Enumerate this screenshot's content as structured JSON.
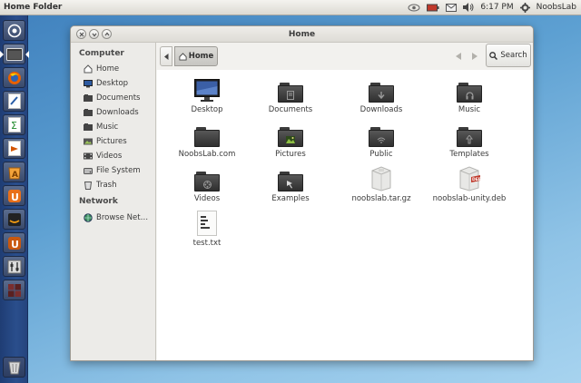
{
  "top_panel": {
    "title": "Home Folder",
    "clock": "6:17 PM",
    "user": "NoobsLab"
  },
  "launcher": {
    "items": [
      "dash-home",
      "file-manager",
      "firefox",
      "libreoffice-writer",
      "libreoffice-calc",
      "libreoffice-impress",
      "software-center",
      "ubuntu-one",
      "amazon",
      "ubuntu-one-music",
      "system-settings",
      "workspace-switcher",
      "trash"
    ]
  },
  "window": {
    "title": "Home"
  },
  "sidebar": {
    "sections": [
      {
        "heading": "Computer",
        "items": [
          {
            "label": "Home",
            "icon": "home-icon"
          },
          {
            "label": "Desktop",
            "icon": "desktop-icon"
          },
          {
            "label": "Documents",
            "icon": "folder-icon"
          },
          {
            "label": "Downloads",
            "icon": "folder-icon"
          },
          {
            "label": "Music",
            "icon": "folder-icon"
          },
          {
            "label": "Pictures",
            "icon": "pictures-icon"
          },
          {
            "label": "Videos",
            "icon": "videos-icon"
          },
          {
            "label": "File System",
            "icon": "drive-icon"
          },
          {
            "label": "Trash",
            "icon": "trash-icon"
          }
        ]
      },
      {
        "heading": "Network",
        "items": [
          {
            "label": "Browse Net…",
            "icon": "network-icon"
          }
        ]
      }
    ]
  },
  "toolbar": {
    "breadcrumb": "Home",
    "search_label": "Search"
  },
  "files": [
    {
      "name": "Desktop",
      "type": "desktop"
    },
    {
      "name": "Documents",
      "type": "folder-documents"
    },
    {
      "name": "Downloads",
      "type": "folder-downloads"
    },
    {
      "name": "Music",
      "type": "folder-music"
    },
    {
      "name": "NoobsLab.com",
      "type": "folder"
    },
    {
      "name": "Pictures",
      "type": "folder-pictures"
    },
    {
      "name": "Public",
      "type": "folder-public"
    },
    {
      "name": "Templates",
      "type": "folder-templates"
    },
    {
      "name": "Videos",
      "type": "folder-videos"
    },
    {
      "name": "Examples",
      "type": "folder-examples"
    },
    {
      "name": "noobslab.tar.gz",
      "type": "archive"
    },
    {
      "name": "noobslab-unity.deb",
      "type": "deb-package"
    },
    {
      "name": "test.txt",
      "type": "text-file"
    }
  ],
  "colors": {
    "launcher": "#2a4e8c",
    "desktop": "#5da0d2",
    "folder": "#3b3b3b"
  }
}
